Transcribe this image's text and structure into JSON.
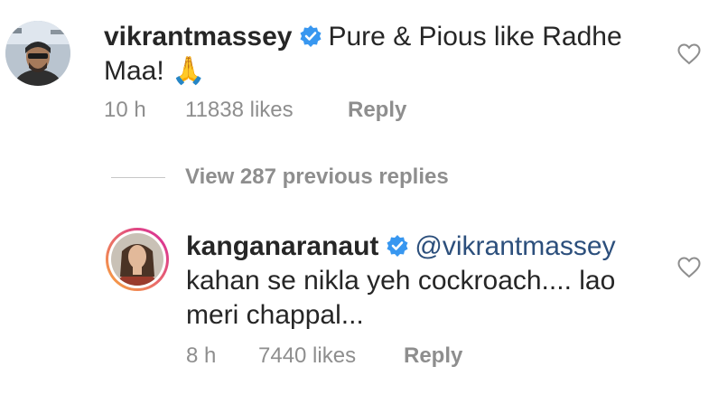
{
  "comments": [
    {
      "username": "vikrantmassey",
      "mention": "",
      "text_line1": "Pure & Pious like Radhe",
      "text_line2": "Maa! 🙏",
      "time": "10 h",
      "likes": "11838 likes",
      "reply_label": "Reply",
      "icons": {
        "verified": "verified-badge-icon",
        "like": "heart-outline-icon"
      }
    },
    {
      "username": "kanganaranaut",
      "mention": "@vikrantmassey",
      "text_line1": "kahan se nikla yeh cockroach.... lao",
      "text_line2": "meri chappal...",
      "time": "8 h",
      "likes": "7440 likes",
      "reply_label": "Reply",
      "icons": {
        "verified": "verified-badge-icon",
        "like": "heart-outline-icon"
      }
    }
  ],
  "view_replies_label": "View 287 previous replies",
  "colors": {
    "verified_blue": "#3897f0",
    "meta_gray": "#8e8e8e",
    "mention_blue": "#2c4f7c",
    "story_ring_start": "#f9a93b",
    "story_ring_end": "#d6249f"
  }
}
